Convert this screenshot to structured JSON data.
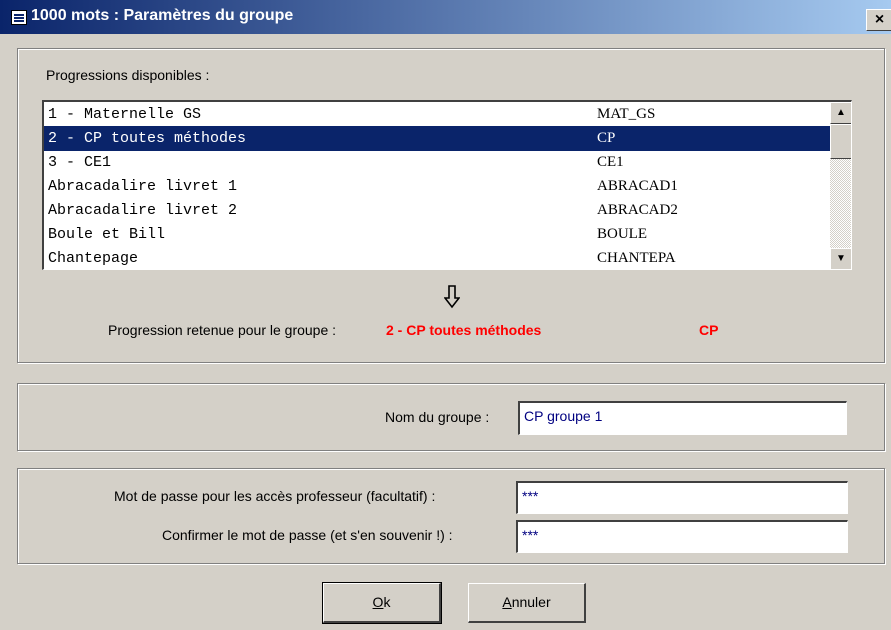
{
  "window": {
    "title": "1000 mots : Paramètres du groupe",
    "close_label": "×"
  },
  "progressions": {
    "label": "Progressions disponibles :",
    "items": [
      {
        "name": "1 - Maternelle GS",
        "code": "MAT_GS"
      },
      {
        "name": "2 - CP toutes méthodes",
        "code": "CP"
      },
      {
        "name": "3 - CE1",
        "code": "CE1"
      },
      {
        "name": "Abracadalire livret 1",
        "code": "ABRACAD1"
      },
      {
        "name": "Abracadalire livret 2",
        "code": "ABRACAD2"
      },
      {
        "name": "Boule et Bill",
        "code": "BOULE"
      },
      {
        "name": "Chantepage",
        "code": "CHANTEPA"
      }
    ],
    "selected_index": 1,
    "arrow_glyph": "⇩",
    "retained_label": "Progression retenue pour le groupe :",
    "retained_name": "2 - CP toutes méthodes",
    "retained_code": "CP"
  },
  "group_name": {
    "label": "Nom du groupe :",
    "value": "CP groupe 1"
  },
  "password": {
    "label": "Mot de passe pour les accès professeur (facultatif) :",
    "value": "***",
    "confirm_label": "Confirmer le mot de passe (et s'en souvenir !) :",
    "confirm_value": "***"
  },
  "buttons": {
    "ok": "Ok",
    "cancel": "Annuler"
  },
  "colors": {
    "selection": "#0a246a",
    "highlight": "#ff0000",
    "field_text": "#000080"
  }
}
